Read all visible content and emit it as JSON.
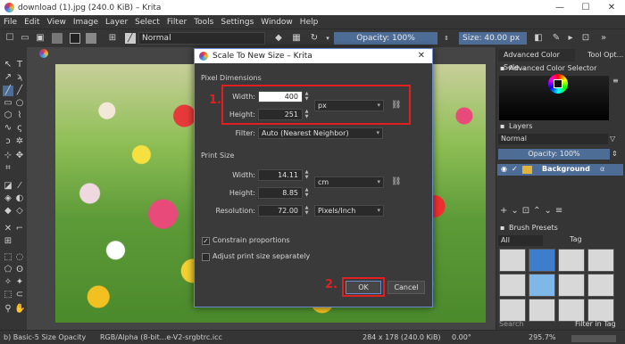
{
  "window": {
    "title": "download (1).jpg (240.0 KiB) – Krita",
    "minimize": "—",
    "maximize": "☐",
    "close": "✕"
  },
  "menu": [
    "File",
    "Edit",
    "View",
    "Image",
    "Layer",
    "Select",
    "Filter",
    "Tools",
    "Settings",
    "Window",
    "Help"
  ],
  "toolbar": {
    "blend_mode": "Normal",
    "opacity": "Opacity: 100%",
    "size": "Size: 40.00 px"
  },
  "dock": {
    "tabs": [
      "Advanced Color Sele...",
      "Tool Opt..."
    ],
    "color_selector_title": "Advanced Color Selector",
    "layers_title": "Layers",
    "layers_blend": "Normal",
    "layers_opacity": "Opacity:  100%",
    "layer_name": "Background",
    "brush_presets_title": "Brush Presets",
    "brush_filter": "All",
    "brush_tag": "Tag",
    "search_placeholder": "Search",
    "filter_in_tag": "Filter in Tag"
  },
  "dialog": {
    "title": "Scale To New Size – Krita",
    "close": "✕",
    "pixel_dimensions_label": "Pixel Dimensions",
    "width_label": "Width:",
    "width_value": "400",
    "height_label": "Height:",
    "height_value": "251",
    "pixel_unit": "px",
    "filter_label": "Filter:",
    "filter_value": "Auto (Nearest Neighbor)",
    "print_size_label": "Print Size",
    "print_width_label": "Width:",
    "print_width_value": "14.11",
    "print_height_label": "Height:",
    "print_height_value": "8.85",
    "print_unit": "cm",
    "resolution_label": "Resolution:",
    "resolution_value": "72.00",
    "resolution_unit": "Pixels/Inch",
    "constrain_label": "Constrain proportions",
    "adjust_label": "Adjust print size separately",
    "ok_label": "OK",
    "cancel_label": "Cancel",
    "annotation_1": "1.",
    "annotation_2": "2."
  },
  "status": {
    "brush": "b) Basic-5 Size Opacity",
    "color": "RGB/Alpha (8-bit...e-V2-srgbtrc.icc",
    "dimensions": "284 x 178 (240.0 KiB)",
    "rotation": "0.00°",
    "zoom": "295.7%"
  },
  "colors": {
    "accent": "#4e6d96",
    "annotation": "#e02020"
  }
}
